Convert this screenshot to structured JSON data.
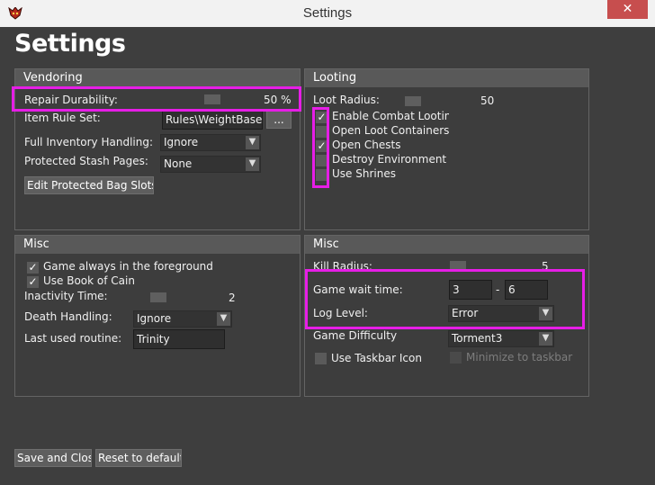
{
  "window": {
    "title": "Settings",
    "close_glyph": "✕",
    "icon": "diablo-app-icon"
  },
  "page_title": "Settings",
  "vendoring": {
    "header": "Vendoring",
    "repair_durability_label": "Repair Durability:",
    "repair_durability_value": "50 %",
    "item_rule_set_label": "Item Rule Set:",
    "item_rule_set_value": "Rules\\WeightBased",
    "browse_label": "...",
    "full_inventory_label": "Full Inventory Handling:",
    "full_inventory_value": "Ignore",
    "protected_stash_label": "Protected Stash Pages:",
    "protected_stash_value": "None",
    "edit_bag_slots_label": "Edit Protected Bag Slots"
  },
  "looting": {
    "header": "Looting",
    "loot_radius_label": "Loot Radius:",
    "loot_radius_value": "50",
    "options": [
      {
        "label": "Enable Combat Looting",
        "checked": true
      },
      {
        "label": "Open Loot Containers",
        "checked": false
      },
      {
        "label": "Open Chests",
        "checked": true
      },
      {
        "label": "Destroy Environment",
        "checked": false
      },
      {
        "label": "Use Shrines",
        "checked": false
      }
    ]
  },
  "misc_left": {
    "header": "Misc",
    "game_foreground_label": "Game always in the foreground",
    "game_foreground_checked": true,
    "use_book_label": "Use Book of Cain",
    "use_book_checked": true,
    "inactivity_label": "Inactivity Time:",
    "inactivity_value": "2",
    "death_handling_label": "Death Handling:",
    "death_handling_value": "Ignore",
    "last_routine_label": "Last used routine:",
    "last_routine_value": "Trinity"
  },
  "misc_right": {
    "header": "Misc",
    "kill_radius_label": "Kill Radius:",
    "kill_radius_value": "5",
    "game_wait_label": "Game wait time:",
    "game_wait_min": "3",
    "game_wait_sep": "-",
    "game_wait_max": "6",
    "log_level_label": "Log Level:",
    "log_level_value": "Error",
    "difficulty_label": "Game Difficulty",
    "difficulty_value": "Torment3",
    "taskbar_icon_label": "Use Taskbar Icon",
    "taskbar_icon_checked": false,
    "minimize_label": "Minimize to taskbar",
    "minimize_checked": false
  },
  "footer": {
    "save_close_label": "Save and Close",
    "reset_label": "Reset to defaults"
  },
  "colors": {
    "highlight": "#e61ee6",
    "background": "#3e3e3e",
    "panel_header": "#595959",
    "close_button": "#c74e4e"
  }
}
